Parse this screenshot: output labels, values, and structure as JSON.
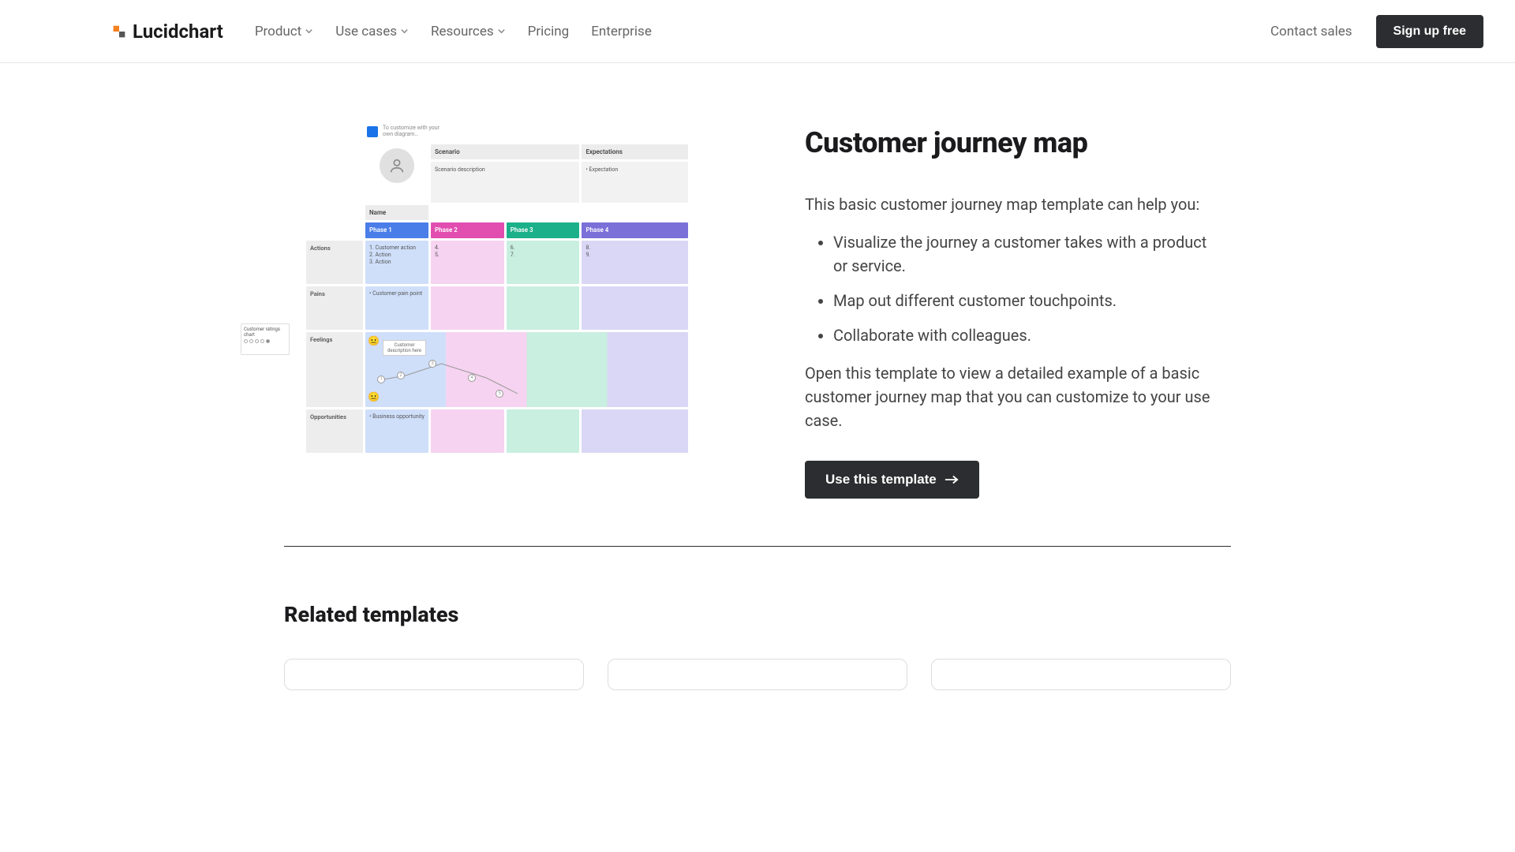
{
  "header": {
    "brand": "Lucidchart",
    "nav": {
      "product": "Product",
      "usecases": "Use cases",
      "resources": "Resources",
      "pricing": "Pricing",
      "enterprise": "Enterprise"
    },
    "contact": "Contact sales",
    "signup": "Sign up free"
  },
  "content": {
    "title": "Customer journey map",
    "intro": "This basic customer journey map template can help you:",
    "bullets": {
      "b1": "Visualize the journey a customer takes with a product or service.",
      "b2": "Map out different customer touchpoints.",
      "b3": "Collaborate with colleagues."
    },
    "outro": "Open this template to view a detailed example of a basic customer journey map that you can customize to your use case.",
    "cta": "Use this template"
  },
  "diagram": {
    "hint": "To customize with your own diagram…",
    "scenario_label": "Scenario",
    "expectations_label": "Expectations",
    "scenario_text": "Scenario description",
    "expectations_text": "• Expectation",
    "name_label": "Name",
    "phases": {
      "p1": "Phase 1",
      "p2": "Phase 2",
      "p3": "Phase 3",
      "p4": "Phase 4"
    },
    "rows": {
      "actions": "Actions",
      "pains": "Pains",
      "feelings": "Feelings",
      "opps": "Opportunities"
    },
    "actions_text": "1. Customer action\n2. Action\n3. Action",
    "actions_num4": "4.",
    "actions_num5": "5.",
    "actions_num6": "6.",
    "actions_num7": "7.",
    "actions_num8": "8.",
    "actions_num9": "9.",
    "pains_text": "• Customer pain point",
    "card_label": "Customer ratings chart",
    "callout": "Customer description here",
    "opps_text": "• Business opportunity"
  },
  "related": {
    "heading": "Related templates"
  }
}
